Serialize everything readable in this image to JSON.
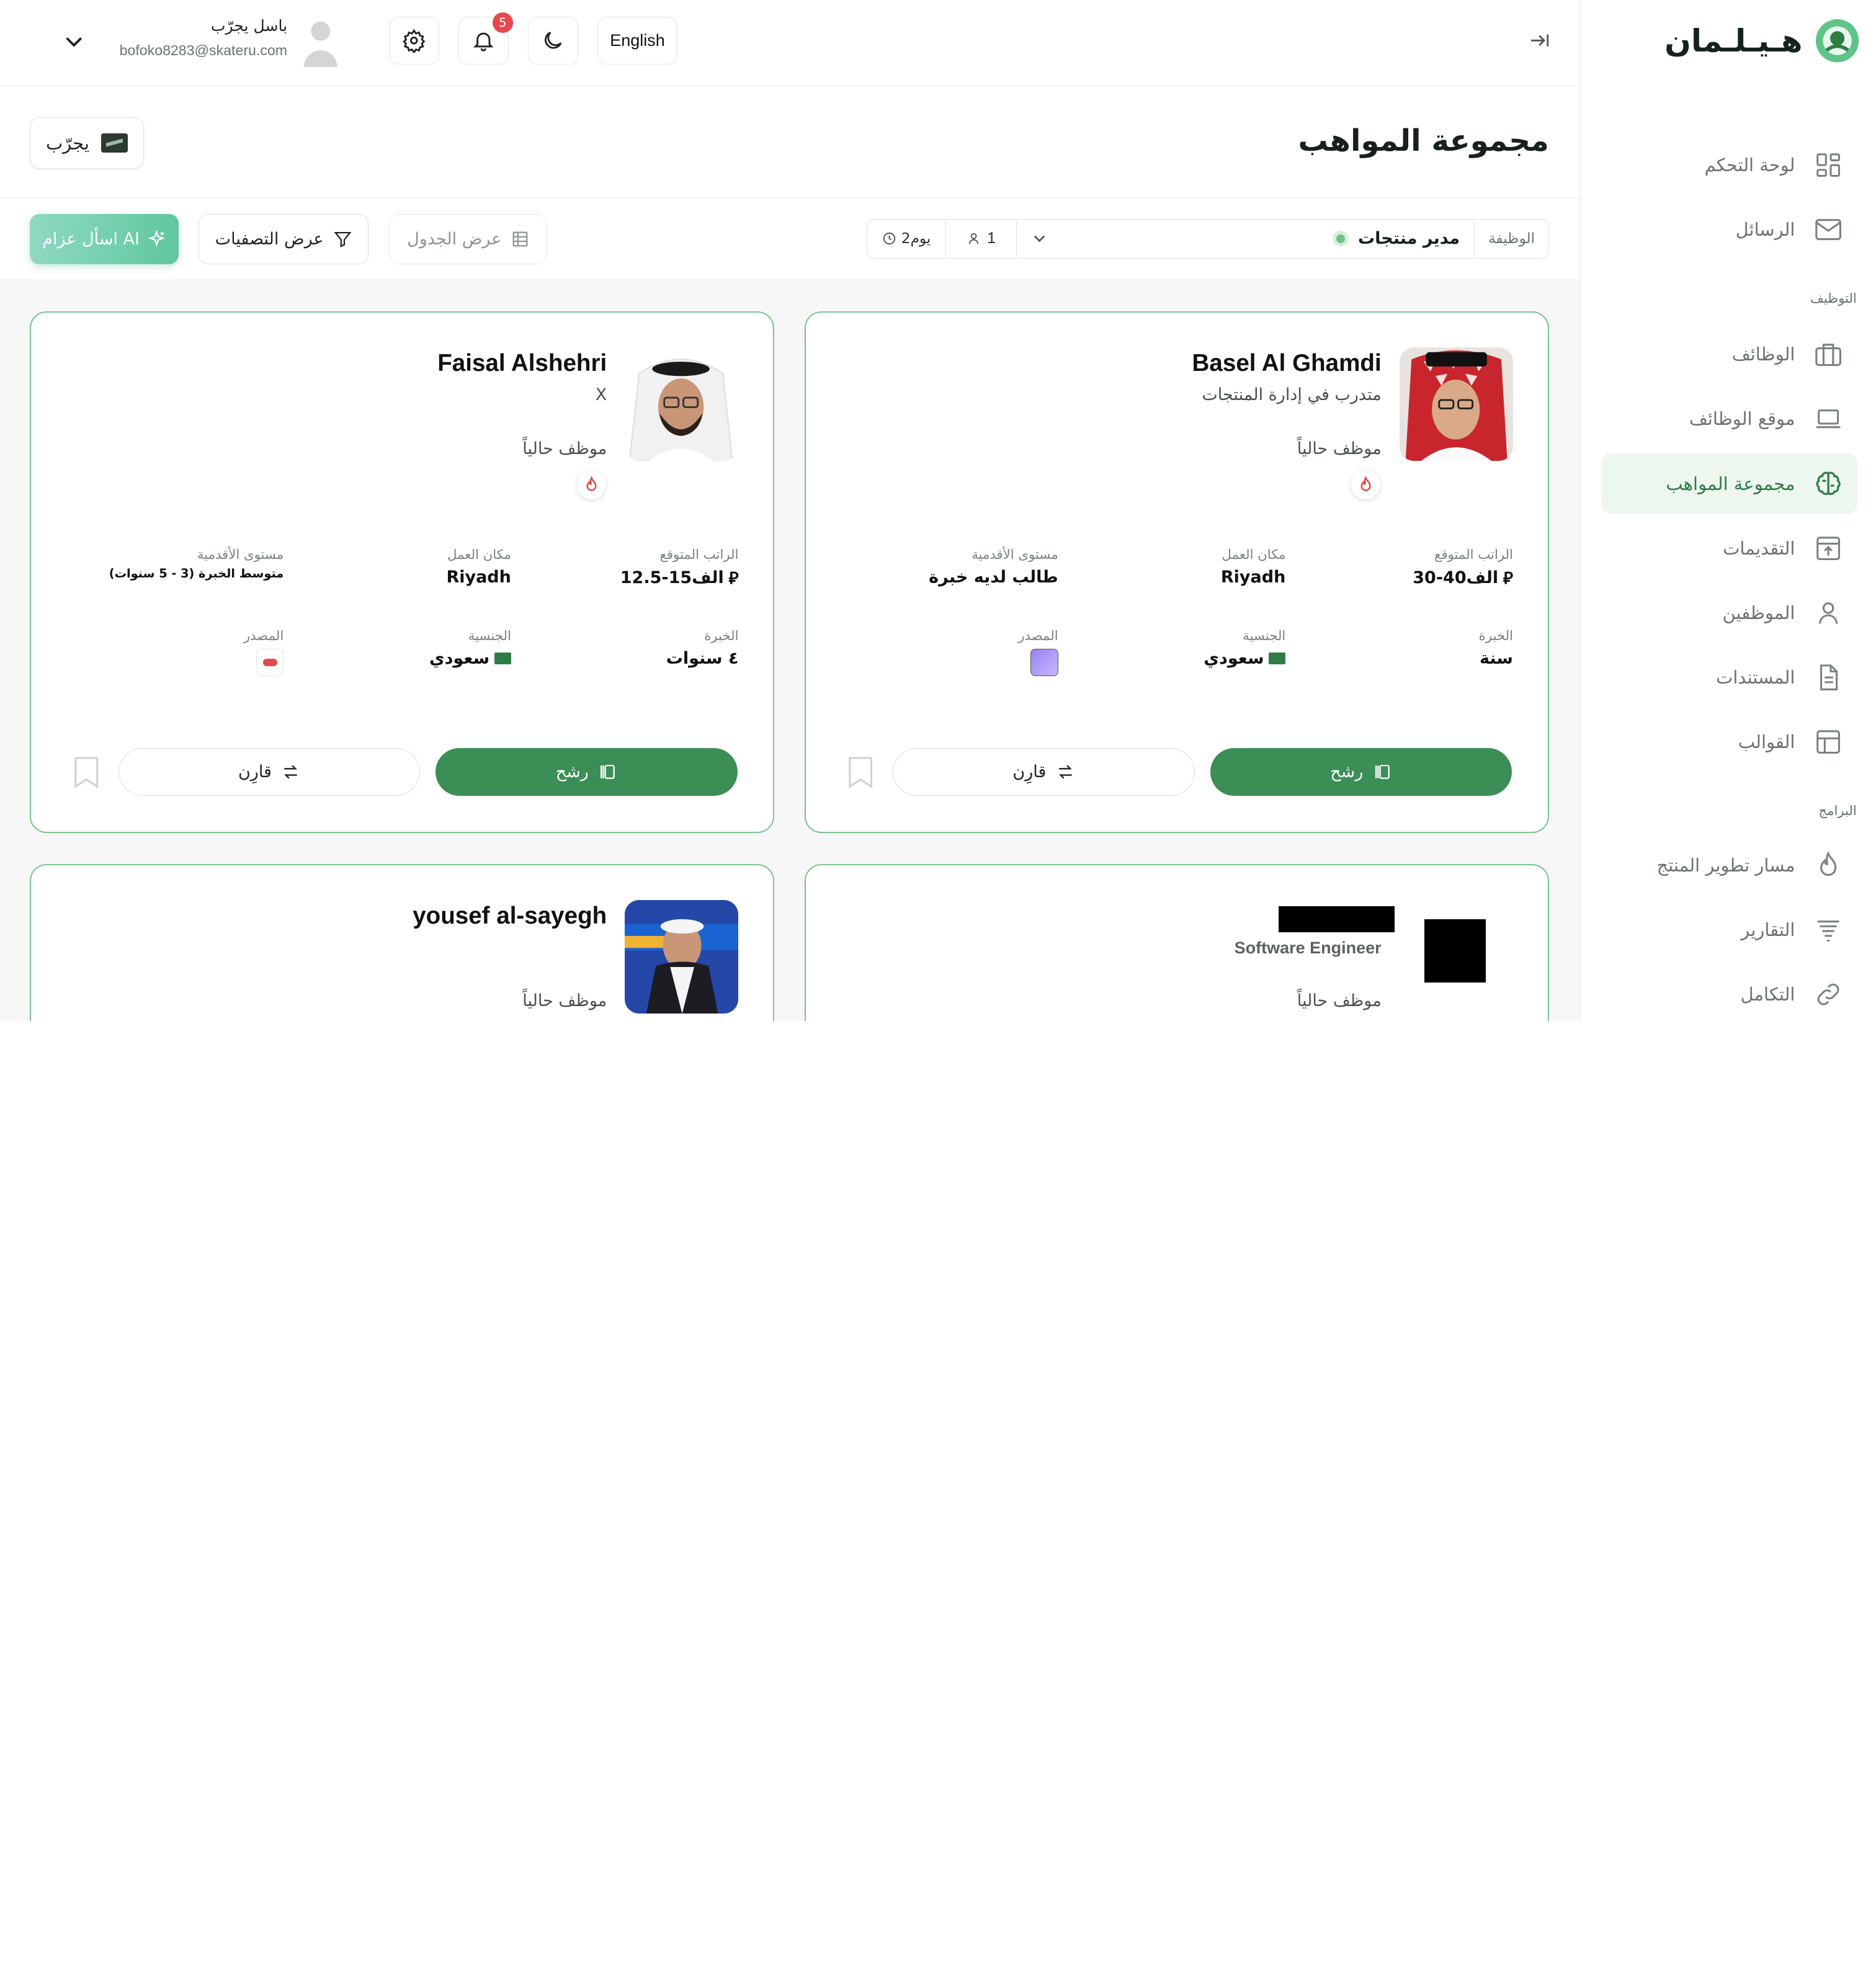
{
  "brand": {
    "name": "هـيـلـمان"
  },
  "nav": {
    "items": [
      {
        "key": "dashboard",
        "label": "لوحة التحكم",
        "icon": "dashboard-grid-icon",
        "active": false
      },
      {
        "key": "messages",
        "label": "الرسائل",
        "icon": "mail-icon",
        "active": false
      },
      {
        "key": "jobs",
        "label": "الوظائف",
        "icon": "briefcase-icon",
        "active": false
      },
      {
        "key": "jobsite",
        "label": "موقع الوظائف",
        "icon": "laptop-icon",
        "active": false
      },
      {
        "key": "talent",
        "label": "مجموعة المواهب",
        "icon": "brain-icon",
        "active": true
      },
      {
        "key": "applications",
        "label": "التقديمات",
        "icon": "inbox-upload-icon",
        "active": false
      },
      {
        "key": "employees",
        "label": "الموظفين",
        "icon": "user-icon",
        "active": false
      },
      {
        "key": "documents",
        "label": "المستندات",
        "icon": "document-icon",
        "active": false
      },
      {
        "key": "templates",
        "label": "القوالب",
        "icon": "template-icon",
        "active": false
      },
      {
        "key": "product",
        "label": "مسار تطوير المنتج",
        "icon": "flame-icon",
        "active": false
      },
      {
        "key": "reports",
        "label": "التقارير",
        "icon": "filter-lines-icon",
        "active": false
      },
      {
        "key": "integrations",
        "label": "التكامل",
        "icon": "link-icon",
        "active": false
      }
    ],
    "section_hiring": "التوظيف",
    "section_programs": "البرامج"
  },
  "header": {
    "language": "English",
    "notifications_count": "5",
    "user_name": "باسل يجرّب",
    "user_email": "bofoko8283@skateru.com"
  },
  "page": {
    "title": "مجموعة المواهب",
    "company": "يجرّب"
  },
  "toolbar": {
    "ai_label": "اسأل عزام AI",
    "filters_label": "عرض التصفيات",
    "table_label": "عرض الجدول",
    "job_label": "الوظيفة",
    "job_value": "مدير منتجات",
    "applicants_count": "1",
    "age": "2يوم"
  },
  "labels": {
    "salary": "الراتب المتوقع",
    "location": "مكان العمل",
    "seniority": "مستوى الأقدمية",
    "experience": "الخبرة",
    "nationality": "الجنسية",
    "source": "المصدر",
    "nominate": "رشح",
    "compare": "قارِن"
  },
  "candidates": [
    {
      "name": "Basel Al Ghamdi",
      "title": "متدرب في إدارة المنتجات",
      "status": "موظف حالياً",
      "salary": "30-40الف",
      "location": "Riyadh",
      "seniority": "طالب لديه خبرة",
      "experience": "سنة",
      "nationality": "سعودي"
    },
    {
      "name": "Faisal Alshehri",
      "title": "X",
      "status": "موظف حالياً",
      "salary": "12.5-15الف",
      "location": "Riyadh",
      "seniority": "متوسط الخبرة (3 - 5 سنوات)",
      "experience": "٤ سنوات",
      "nationality": "سعودي"
    },
    {
      "name": "",
      "title": "Software Engineer",
      "status": "موظف حالياً"
    },
    {
      "name": "yousef al-sayegh",
      "title": "",
      "status": "موظف حالياً"
    }
  ],
  "colors": {
    "primary": "#3b8e56",
    "card_border": "#7cc391",
    "active_nav_bg": "#edf6ef",
    "badge": "#e5484d",
    "ai_gradient_start": "#8fd9c2",
    "ai_gradient_end": "#5fc79e"
  }
}
